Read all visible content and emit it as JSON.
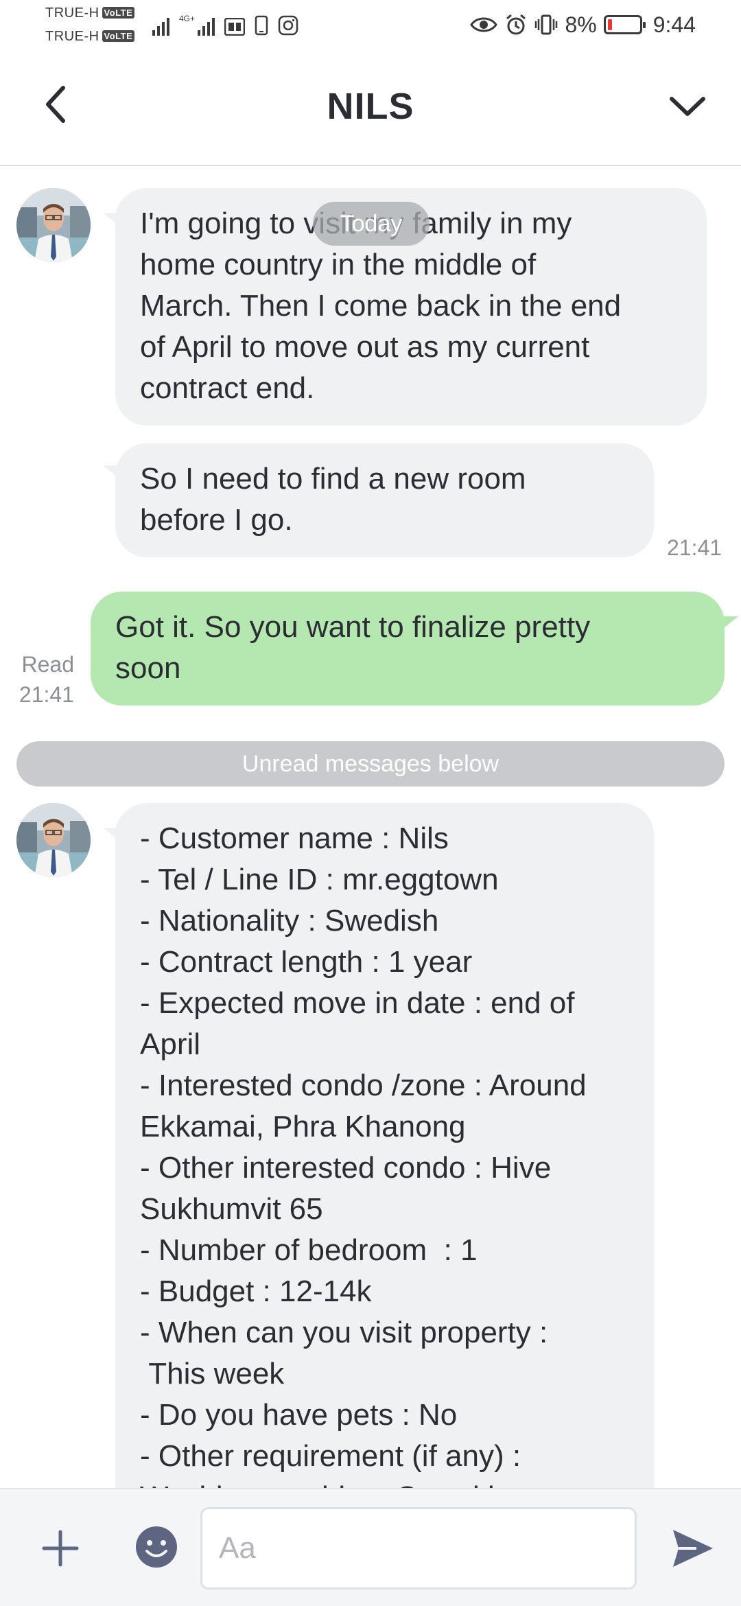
{
  "status_bar": {
    "carrier_1": "TRUE-H",
    "carrier_2": "TRUE-H",
    "volte_badge": "VoLTE",
    "network_type": "4G+",
    "battery_percent": "8%",
    "time": "9:44"
  },
  "header": {
    "title": "NILS"
  },
  "chat": {
    "date_label": "Today",
    "unread_label": "Unread messages below",
    "messages": [
      {
        "direction": "incoming",
        "text": "I'm going to visit my family in my\nhome country in the middle of\nMarch. Then I come back in the end\nof April to move out as my current\ncontract end."
      },
      {
        "direction": "incoming",
        "text": "So I need to find a new room\nbefore I go.",
        "time": "21:41"
      },
      {
        "direction": "outgoing",
        "text": "Got it. So you want to finalize pretty\nsoon",
        "read_label": "Read",
        "time": "21:41"
      },
      {
        "direction": "incoming",
        "text": "- Customer name : Nils\n- Tel / Line ID : mr.eggtown\n- Nationality : Swedish\n- Contract length : 1 year\n- Expected move in date : end of\nApril\n- Interested condo /zone : Around\nEkkamai, Phra Khanong\n- Other interested condo : Hive\nSukhumvit 65\n- Number of bedroom  : 1\n- Budget : 12-14k\n- When can you visit property :\n This week\n- Do you have pets : No\n- Other requirement (if any) :\nWashing machine, Cozy kitc"
      }
    ]
  },
  "input_bar": {
    "placeholder": "Aa"
  },
  "colors": {
    "incoming_bubble": "#f0f1f3",
    "outgoing_bubble": "#b5e8b0",
    "icon_color": "#5d6581"
  }
}
